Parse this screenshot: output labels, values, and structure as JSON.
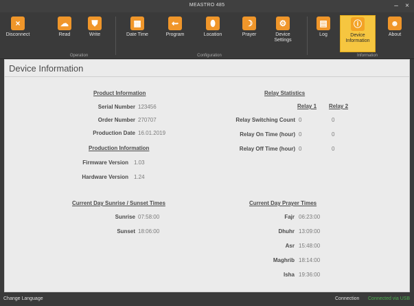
{
  "window": {
    "title": "MEASTRO 485",
    "minimize": "–",
    "close": "×"
  },
  "ribbon": {
    "buttons": [
      {
        "label": "Disconnect",
        "icon": "×"
      },
      {
        "label": "Read",
        "icon": "☁"
      },
      {
        "label": "Write",
        "icon": "⛊"
      },
      {
        "label": "Date Time",
        "icon": "▦"
      },
      {
        "label": "Program",
        "icon": "⇜"
      },
      {
        "label": "Location",
        "icon": "⬮"
      },
      {
        "label": "Prayer",
        "icon": "☽"
      },
      {
        "label": "Device Settings",
        "icon": "⚙"
      },
      {
        "label": "Log",
        "icon": "▤"
      },
      {
        "label": "Device Information",
        "icon": "ⓘ"
      },
      {
        "label": "About",
        "icon": "☻"
      }
    ],
    "groups": {
      "operation": "Operation",
      "configuration": "Configuration",
      "information": "Information"
    }
  },
  "page": {
    "title": "Device Information"
  },
  "product": {
    "header": "Product Information",
    "serial_label": "Serial Number",
    "serial_value": "123456",
    "order_label": "Order Number",
    "order_value": "270707",
    "prod_date_label": "Production Date",
    "prod_date_value": "16.01.2019"
  },
  "production": {
    "header": "Production Information",
    "firmware_label": "Firmware Version",
    "firmware_value": "1.03",
    "hardware_label": "Hardware Version",
    "hardware_value": "1.24"
  },
  "relay": {
    "header": "Relay Statistics",
    "col1": "Relay 1",
    "col2": "Relay 2",
    "rows": [
      {
        "label": "Relay Switching Count",
        "r1": "0",
        "r2": "0"
      },
      {
        "label": "Relay On Time (hour)",
        "r1": "0",
        "r2": "0"
      },
      {
        "label": "Relay Off Time (hour)",
        "r1": "0",
        "r2": "0"
      }
    ]
  },
  "sun": {
    "header": "Current Day Sunrise / Sunset Times",
    "sunrise_label": "Sunrise",
    "sunrise_value": "07:58:00",
    "sunset_label": "Sunset",
    "sunset_value": "18:06:00"
  },
  "prayer": {
    "header": "Current Day Prayer Times",
    "rows": [
      {
        "label": "Fajr",
        "value": "06:23:00"
      },
      {
        "label": "Dhuhr",
        "value": "13:09:00"
      },
      {
        "label": "Asr",
        "value": "15:48:00"
      },
      {
        "label": "Maghrib",
        "value": "18:14:00"
      },
      {
        "label": "Isha",
        "value": "19:36:00"
      }
    ]
  },
  "status": {
    "change_language": "Change Language",
    "connection_label": "Connection",
    "connection_value": "Connected via USB"
  },
  "colors": {
    "accent": "#f0962a",
    "active": "#f6c640",
    "connected": "#4caf50"
  }
}
